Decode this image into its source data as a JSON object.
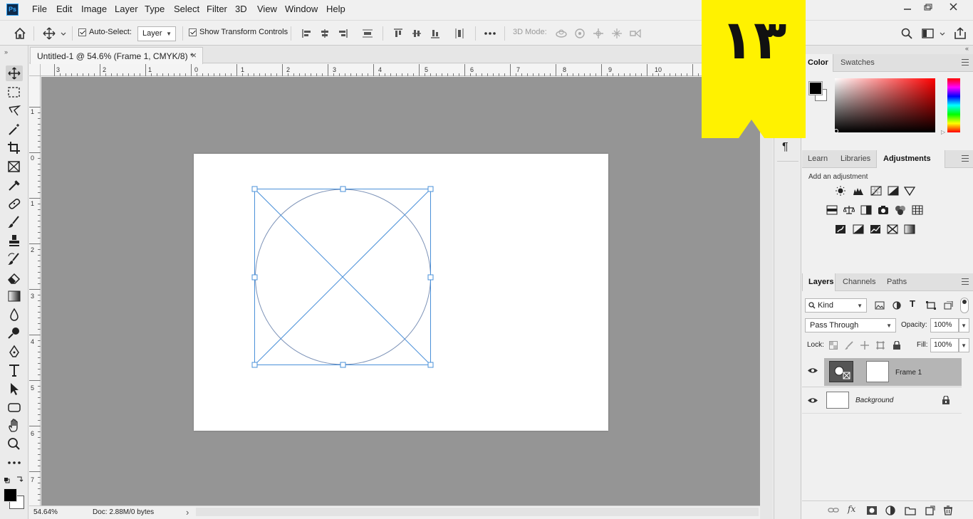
{
  "app": {
    "logo_text": "Ps",
    "menu": [
      "File",
      "Edit",
      "Image",
      "Layer",
      "Type",
      "Select",
      "Filter",
      "3D",
      "View",
      "Window",
      "Help"
    ]
  },
  "options_bar": {
    "auto_select_label": "Auto-Select:",
    "auto_select_checked": true,
    "target_dropdown": "Layer",
    "show_transform_label": "Show Transform Controls",
    "show_transform_checked": true,
    "mode_3d_label": "3D Mode:"
  },
  "document": {
    "tab_title": "Untitled-1 @ 54.6% (Frame 1, CMYK/8) *",
    "close_glyph": "×",
    "zoom": "54.64%",
    "doc_info": "Doc: 2.88M/0 bytes",
    "status_arrow": "›"
  },
  "rulers": {
    "top": [
      "3",
      "2",
      "1",
      "0",
      "1",
      "2",
      "3",
      "4",
      "5",
      "6",
      "7",
      "8",
      "9",
      "10"
    ],
    "left": [
      "1",
      "0",
      "1",
      "2",
      "3",
      "4",
      "5",
      "6",
      "7"
    ]
  },
  "color_panel": {
    "tabs": [
      "Color",
      "Swatches"
    ],
    "active_tab": "Color",
    "foreground": "#000000",
    "background": "#ffffff",
    "hue": "#ff0000"
  },
  "adjustments_panel": {
    "tabs": [
      "Learn",
      "Libraries",
      "Adjustments"
    ],
    "active_tab": "Adjustments",
    "hint": "Add an adjustment"
  },
  "layers_panel": {
    "tabs": [
      "Layers",
      "Channels",
      "Paths"
    ],
    "active_tab": "Layers",
    "filter_kind": "Kind",
    "blend_mode": "Pass Through",
    "opacity_label": "Opacity:",
    "opacity": "100%",
    "lock_label": "Lock:",
    "fill_label": "Fill:",
    "fill": "100%",
    "layers": [
      {
        "name": "Frame 1",
        "selected": true,
        "visible": true
      },
      {
        "name": "Background",
        "selected": false,
        "visible": true,
        "locked": true
      }
    ]
  },
  "overlay": {
    "badge_text": "۱۳",
    "badge_color": "#fff200"
  },
  "colors": {
    "accent_frame": "#4a90d9",
    "canvas_bg": "#959595"
  }
}
